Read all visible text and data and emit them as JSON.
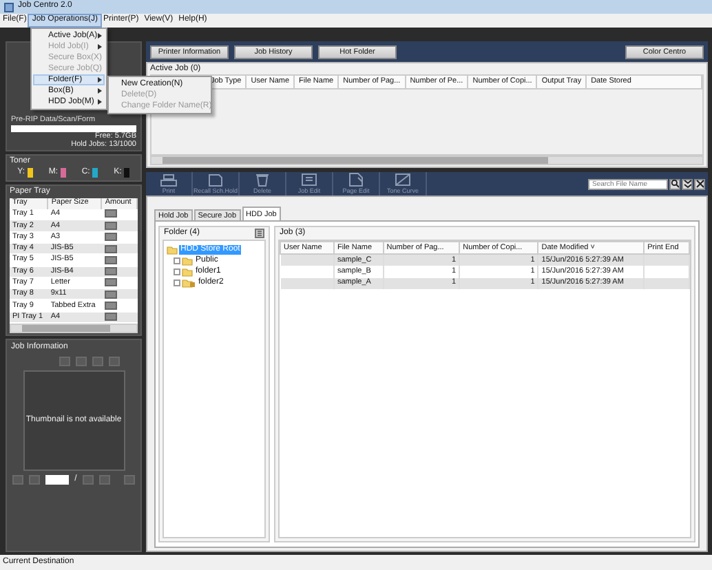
{
  "window": {
    "title": "Job Centro 2.0"
  },
  "menu_bar": [
    {
      "label": "File(F)",
      "selected": false
    },
    {
      "label": "Job Operations(J)",
      "selected": true
    },
    {
      "label": "Printer(P)",
      "selected": false
    },
    {
      "label": "View(V)",
      "selected": false
    },
    {
      "label": "Help(H)",
      "selected": false
    }
  ],
  "open_menu": [
    {
      "label": "Active Job(A)",
      "disabled": false,
      "selected": false
    },
    {
      "label": "Hold Job(I)",
      "disabled": true,
      "selected": false
    },
    {
      "label": "Secure Box(X)",
      "disabled": true,
      "selected": false
    },
    {
      "label": "Secure Job(Q)",
      "disabled": true,
      "selected": false
    },
    {
      "label": "Folder(F)",
      "disabled": false,
      "selected": true
    },
    {
      "label": "Box(B)",
      "disabled": false,
      "selected": false
    },
    {
      "label": "HDD Job(M)",
      "disabled": false,
      "selected": false
    }
  ],
  "submenu": [
    {
      "label": "New Creation(N)",
      "disabled": false
    },
    {
      "label": "Delete(D)",
      "disabled": true
    },
    {
      "label": "Change Folder Name(R)",
      "disabled": true
    }
  ],
  "printer_status": {
    "storage_label": "Pre-RIP Data/Scan/Form",
    "free": "Free: 5.7GB",
    "hold_jobs": "Hold Jobs: 13/1000"
  },
  "toner": {
    "title": "Toner",
    "colors": [
      {
        "label": "Y:",
        "color": "#f2c41c"
      },
      {
        "label": "M:",
        "color": "#d86a9a"
      },
      {
        "label": "C:",
        "color": "#24a8c8"
      },
      {
        "label": "K:",
        "color": "#101010"
      }
    ]
  },
  "paper_tray": {
    "title": "Paper Tray",
    "columns": [
      "Tray",
      "Paper Size",
      "Amount"
    ],
    "rows": [
      [
        "Tray 1",
        "A4"
      ],
      [
        "Tray 2",
        "A4"
      ],
      [
        "Tray 3",
        "A3"
      ],
      [
        "Tray 4",
        "JIS-B5"
      ],
      [
        "Tray 5",
        "JIS-B5"
      ],
      [
        "Tray 6",
        "JIS-B4"
      ],
      [
        "Tray 7",
        "Letter"
      ],
      [
        "Tray 8",
        "9x11"
      ],
      [
        "Tray 9",
        "Tabbed Extra"
      ],
      [
        "PI Tray 1",
        "A4"
      ]
    ]
  },
  "job_information": {
    "title": "Job Information",
    "thumbnail_text": "Thumbnail is not available",
    "page_separator": "/"
  },
  "top_buttons": [
    "Printer Information",
    "Job History",
    "Hot Folder",
    "Color Centro"
  ],
  "active_job": {
    "title": "Active Job (0)",
    "columns": [
      "Job Type",
      "User Name",
      "File Name",
      "Number of Pag...",
      "Number of  Pe...",
      "Number of Copi...",
      "Output Tray",
      "Date Stored"
    ]
  },
  "toolbar": [
    {
      "label": "Print",
      "kind": "print"
    },
    {
      "label": "Recall Sch.Hold",
      "kind": "recall"
    },
    {
      "label": "Delete",
      "kind": "delete"
    },
    {
      "label": "Job Edit",
      "kind": "job-edit"
    },
    {
      "label": "Page Edit",
      "kind": "page-edit"
    },
    {
      "label": "Tone Curve",
      "kind": "tone-curve"
    }
  ],
  "search": {
    "placeholder": "Search File Name"
  },
  "tabs": [
    {
      "label": "Hold Job",
      "selected": false
    },
    {
      "label": "Secure Job",
      "selected": false
    },
    {
      "label": "HDD Job",
      "selected": true
    }
  ],
  "folder_panel": {
    "title": "Folder (4)",
    "tree": [
      {
        "label": "HDD Store Root",
        "selected": true,
        "locked": false,
        "children": [
          {
            "label": "Public",
            "selected": false,
            "locked": false
          },
          {
            "label": "folder1",
            "selected": false,
            "locked": false
          },
          {
            "label": "folder2",
            "selected": false,
            "locked": true
          }
        ]
      }
    ]
  },
  "job_panel": {
    "title": "Job (3)",
    "columns": [
      "User Name",
      "File Name",
      "Number of Pag...",
      "Number of Copi...",
      "Date Modified  ˅",
      "Print End"
    ],
    "rows": [
      [
        "",
        "sample_C",
        "1",
        "1",
        "15/Jun/2016 5:27:39 AM",
        ""
      ],
      [
        "",
        "sample_B",
        "1",
        "1",
        "15/Jun/2016 5:27:39 AM",
        ""
      ],
      [
        "",
        "sample_A",
        "1",
        "1",
        "15/Jun/2016 5:27:39 AM",
        ""
      ]
    ]
  },
  "status_bar": "Current Destination"
}
